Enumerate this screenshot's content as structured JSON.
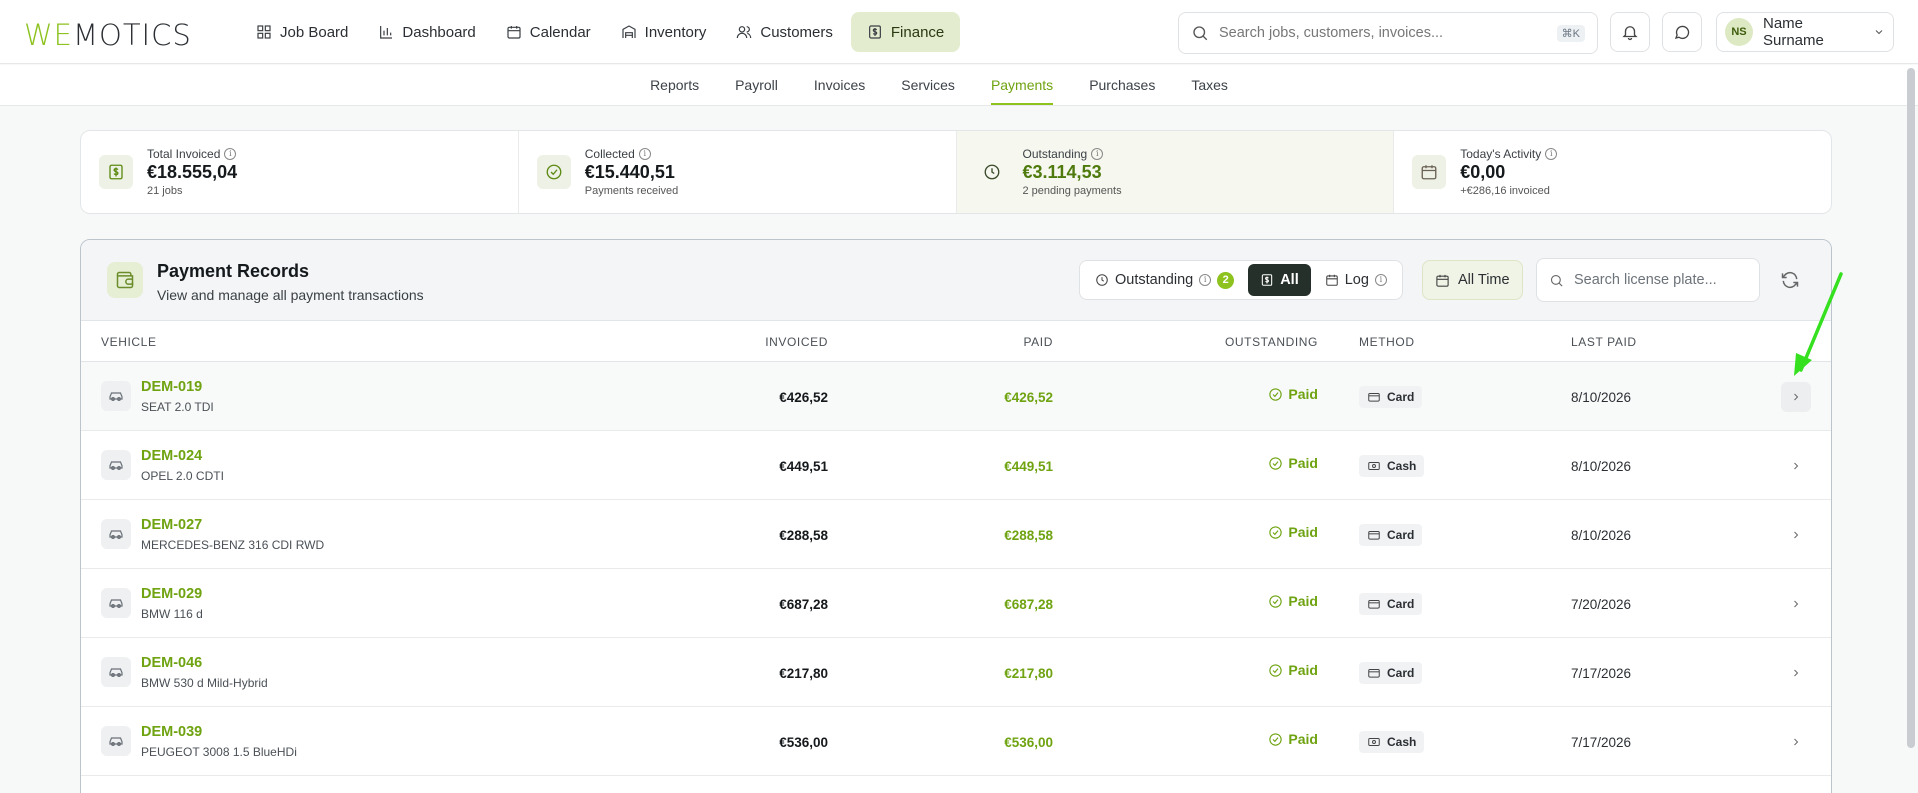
{
  "app": {
    "logo_part1": "WE",
    "logo_part2": "MOTICS",
    "nav": [
      {
        "label": "Job Board",
        "icon": "grid-icon"
      },
      {
        "label": "Dashboard",
        "icon": "bar-chart-icon"
      },
      {
        "label": "Calendar",
        "icon": "calendar-icon"
      },
      {
        "label": "Inventory",
        "icon": "warehouse-icon"
      },
      {
        "label": "Customers",
        "icon": "users-icon"
      },
      {
        "label": "Finance",
        "icon": "dollar-file-icon"
      }
    ],
    "search_placeholder": "Search jobs, customers, invoices...",
    "search_shortcut": "⌘K",
    "user": {
      "initials": "NS",
      "name": "Name Surname"
    }
  },
  "subnav": [
    "Reports",
    "Payroll",
    "Invoices",
    "Services",
    "Payments",
    "Purchases",
    "Taxes"
  ],
  "stats": [
    {
      "label": "Total Invoiced",
      "value": "€18.555,04",
      "sub": "21 jobs"
    },
    {
      "label": "Collected",
      "value": "€15.440,51",
      "sub": "Payments received"
    },
    {
      "label": "Outstanding",
      "value": "€3.114,53",
      "sub": "2 pending payments"
    },
    {
      "label": "Today's Activity",
      "value": "€0,00",
      "sub": "+€286,16 invoiced"
    }
  ],
  "panel": {
    "title": "Payment Records",
    "subtitle": "View and manage all payment transactions",
    "filters": {
      "outstanding": "Outstanding",
      "outstanding_count": "2",
      "all": "All",
      "log": "Log"
    },
    "range": "All Time",
    "plate_placeholder": "Search license plate..."
  },
  "table": {
    "headers": {
      "vehicle": "VEHICLE",
      "invoiced": "INVOICED",
      "paid": "PAID",
      "outstanding": "OUTSTANDING",
      "method": "METHOD",
      "last_paid": "LAST PAID"
    },
    "rows": [
      {
        "plate": "DEM-019",
        "model": "SEAT 2.0 TDI",
        "invoiced": "€426,52",
        "paid": "€426,52",
        "status": "Paid",
        "method": "Card",
        "date": "8/10/2026"
      },
      {
        "plate": "DEM-024",
        "model": "OPEL 2.0 CDTI",
        "invoiced": "€449,51",
        "paid": "€449,51",
        "status": "Paid",
        "method": "Cash",
        "date": "8/10/2026"
      },
      {
        "plate": "DEM-027",
        "model": "MERCEDES-BENZ 316 CDI RWD",
        "invoiced": "€288,58",
        "paid": "€288,58",
        "status": "Paid",
        "method": "Card",
        "date": "8/10/2026"
      },
      {
        "plate": "DEM-029",
        "model": "BMW 116 d",
        "invoiced": "€687,28",
        "paid": "€687,28",
        "status": "Paid",
        "method": "Card",
        "date": "7/20/2026"
      },
      {
        "plate": "DEM-046",
        "model": "BMW 530 d Mild-Hybrid",
        "invoiced": "€217,80",
        "paid": "€217,80",
        "status": "Paid",
        "method": "Card",
        "date": "7/17/2026"
      },
      {
        "plate": "DEM-039",
        "model": "PEUGEOT 3008 1.5 BlueHDi",
        "invoiced": "€536,00",
        "paid": "€536,00",
        "status": "Paid",
        "method": "Cash",
        "date": "7/17/2026"
      }
    ]
  },
  "colors": {
    "accent": "#8dc21f",
    "accent_text": "#6fa311",
    "annotation_arrow": "#35e01f"
  }
}
